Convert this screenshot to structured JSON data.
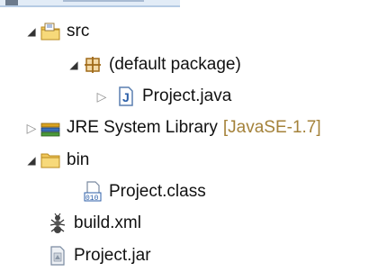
{
  "tree": {
    "src": {
      "label": "src"
    },
    "default_package": {
      "label": "(default package)"
    },
    "project_java": {
      "label": "Project.java"
    },
    "jre": {
      "label": "JRE System Library",
      "qualifier": "[JavaSE-1.7]"
    },
    "bin": {
      "label": "bin"
    },
    "project_class": {
      "label": "Project.class"
    },
    "build_xml": {
      "label": "build.xml"
    },
    "project_jar": {
      "label": "Project.jar"
    }
  },
  "icons": {
    "src": "source-folder-icon",
    "default_package": "package-icon",
    "project_java": "java-file-icon",
    "jre": "library-icon",
    "bin": "folder-icon",
    "project_class": "class-file-icon",
    "build_xml": "ant-build-icon",
    "project_jar": "jar-file-icon"
  },
  "colors": {
    "qualifier": "#a4823a",
    "folder": "#e8b84a",
    "selection_strip": "#e2ecf7"
  }
}
